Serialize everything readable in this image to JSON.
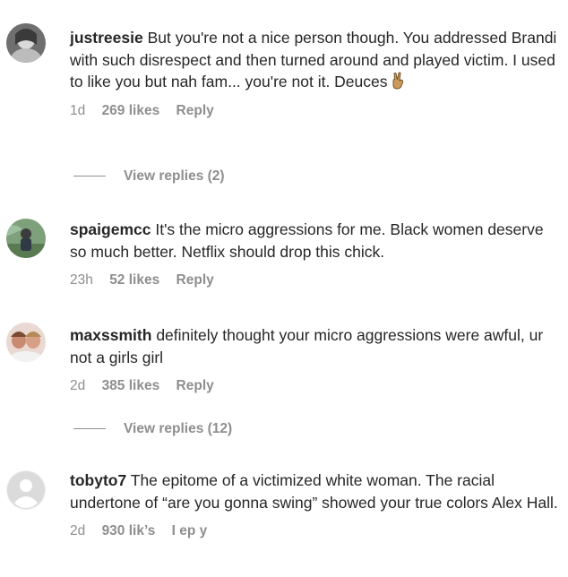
{
  "comments": [
    {
      "username": "justreesie",
      "text": "But you're not a nice person though. You addressed Brandi with such disrespect and then turned around and played victim. I used to like you but nah fam... you're not it. Deuces",
      "emoji": "victory-hand-emoji",
      "time": "1d",
      "likes": "269 likes",
      "reply": "Reply",
      "view_replies": "View replies (2)"
    },
    {
      "username": "spaigemcc",
      "text": "It's the micro aggressions for me. Black women deserve so much better. Netflix should drop this chick.",
      "time": "23h",
      "likes": "52 likes",
      "reply": "Reply"
    },
    {
      "username": "maxssmith",
      "text": "definitely thought your micro aggressions were awful, ur not a girls girl",
      "time": "2d",
      "likes": "385 likes",
      "reply": "Reply",
      "view_replies": "View replies (12)"
    },
    {
      "username": "tobyto7",
      "text": "The epitome of a victimized white woman. The racial undertone of “are you gonna swing” showed your true colors Alex Hall.",
      "time": "2d",
      "likes": "930 lik’s",
      "reply": "I ep y"
    }
  ]
}
